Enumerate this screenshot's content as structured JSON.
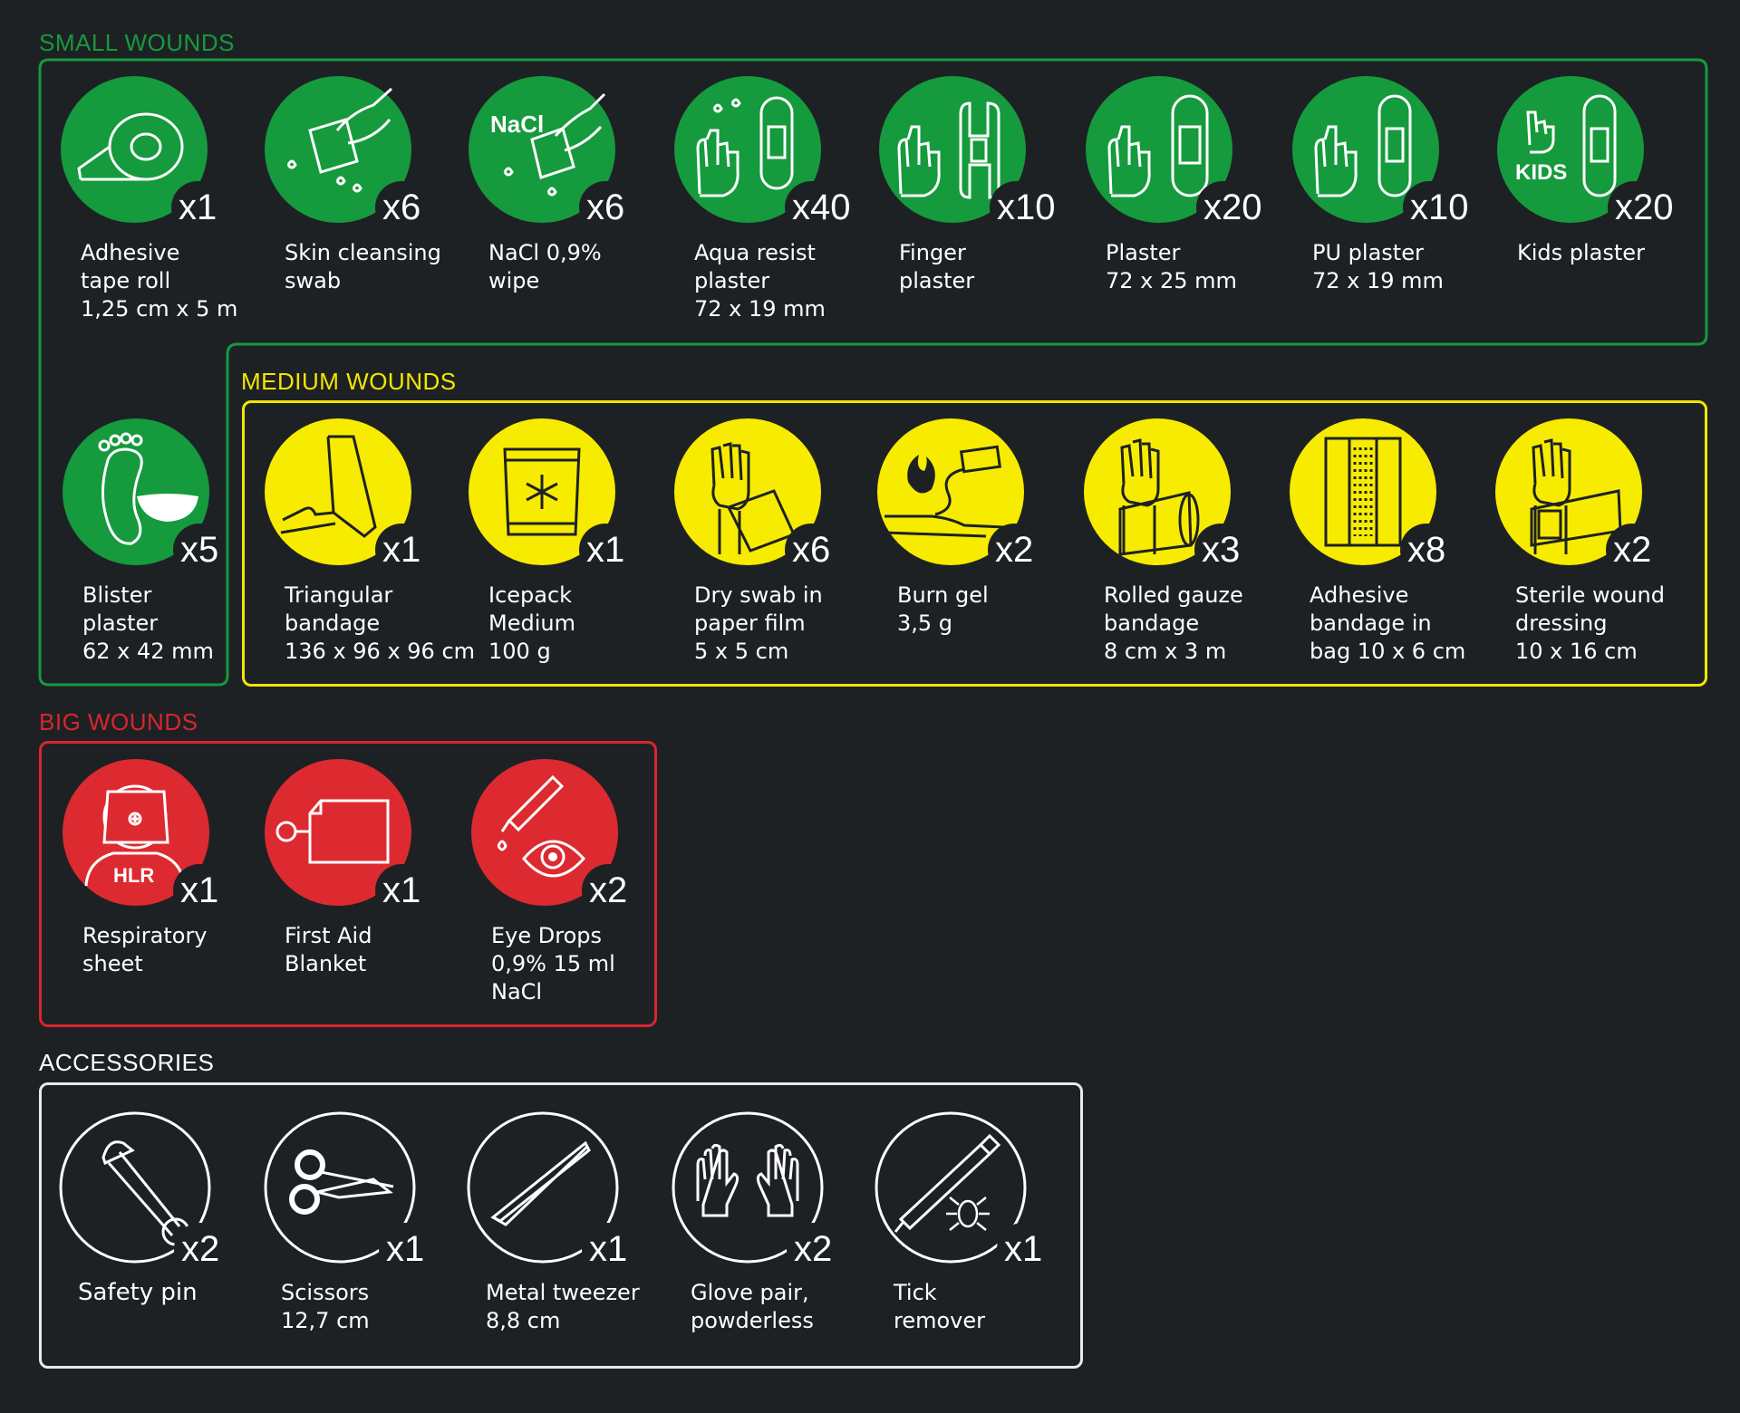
{
  "colors": {
    "background": "#1e2124",
    "green": "#159a3d",
    "yellow": "#f7ec00",
    "red": "#dd2a30",
    "white": "#e9e9e9"
  },
  "sections": {
    "small": {
      "title": "SMALL WOUNDS"
    },
    "medium": {
      "title": "MEDIUM WOUNDS"
    },
    "big": {
      "title": "BIG WOUNDS"
    },
    "accessories": {
      "title": "ACCESSORIES"
    }
  },
  "small_items": [
    {
      "qty": "x1",
      "label": "Adhesive\ntape roll\n1,25 cm x 5 m",
      "icon": "tape-roll-icon"
    },
    {
      "qty": "x6",
      "label": "Skin cleansing\nswab",
      "icon": "cleansing-swab-icon"
    },
    {
      "qty": "x6",
      "label": "NaCl 0,9%\nwipe",
      "icon": "nacl-wipe-icon",
      "icon_text": "NaCl"
    },
    {
      "qty": "x40",
      "label": "Aqua resist\nplaster\n72 x 19 mm",
      "icon": "aqua-plaster-icon"
    },
    {
      "qty": "x10",
      "label": "Finger\nplaster",
      "icon": "finger-plaster-icon"
    },
    {
      "qty": "x20",
      "label": "Plaster\n72 x 25 mm",
      "icon": "plaster-icon"
    },
    {
      "qty": "x10",
      "label": "PU plaster\n72 x 19 mm",
      "icon": "pu-plaster-icon"
    },
    {
      "qty": "x20",
      "label": "Kids plaster",
      "icon": "kids-plaster-icon",
      "icon_text": "KIDS"
    },
    {
      "qty": "x5",
      "label": "Blister\nplaster\n62 x 42 mm",
      "icon": "blister-plaster-icon"
    }
  ],
  "medium_items": [
    {
      "qty": "x1",
      "label": "Triangular\nbandage\n136 x 96 x 96 cm",
      "icon": "triangular-bandage-icon"
    },
    {
      "qty": "x1",
      "label": "Icepack\nMedium\n100 g",
      "icon": "icepack-icon"
    },
    {
      "qty": "x6",
      "label": "Dry swab in\npaper film\n5 x 5 cm",
      "icon": "dry-swab-icon"
    },
    {
      "qty": "x2",
      "label": "Burn gel\n3,5 g",
      "icon": "burn-gel-icon"
    },
    {
      "qty": "x3",
      "label": "Rolled gauze\nbandage\n8 cm x 3 m",
      "icon": "gauze-bandage-icon"
    },
    {
      "qty": "x8",
      "label": "Adhesive\nbandage in\nbag 10 x 6 cm",
      "icon": "adhesive-bandage-icon"
    },
    {
      "qty": "x2",
      "label": "Sterile wound\ndressing\n10 x 16 cm",
      "icon": "wound-dressing-icon"
    }
  ],
  "big_items": [
    {
      "qty": "x1",
      "label": "Respiratory\nsheet",
      "icon": "respiratory-sheet-icon",
      "icon_text": "HLR"
    },
    {
      "qty": "x1",
      "label": "First Aid\nBlanket",
      "icon": "blanket-icon"
    },
    {
      "qty": "x2",
      "label": "Eye Drops\n0,9% 15 ml\nNaCl",
      "icon": "eye-drops-icon"
    }
  ],
  "accessory_items": [
    {
      "qty": "x2",
      "label": "Safety pin",
      "icon": "safety-pin-icon"
    },
    {
      "qty": "x1",
      "label": "Scissors\n12,7 cm",
      "icon": "scissors-icon"
    },
    {
      "qty": "x1",
      "label": "Metal tweezer\n8,8 cm",
      "icon": "tweezer-icon"
    },
    {
      "qty": "x2",
      "label": "Glove pair,\npowderless",
      "icon": "gloves-icon"
    },
    {
      "qty": "x1",
      "label": "Tick\nremover",
      "icon": "tick-remover-icon"
    }
  ]
}
